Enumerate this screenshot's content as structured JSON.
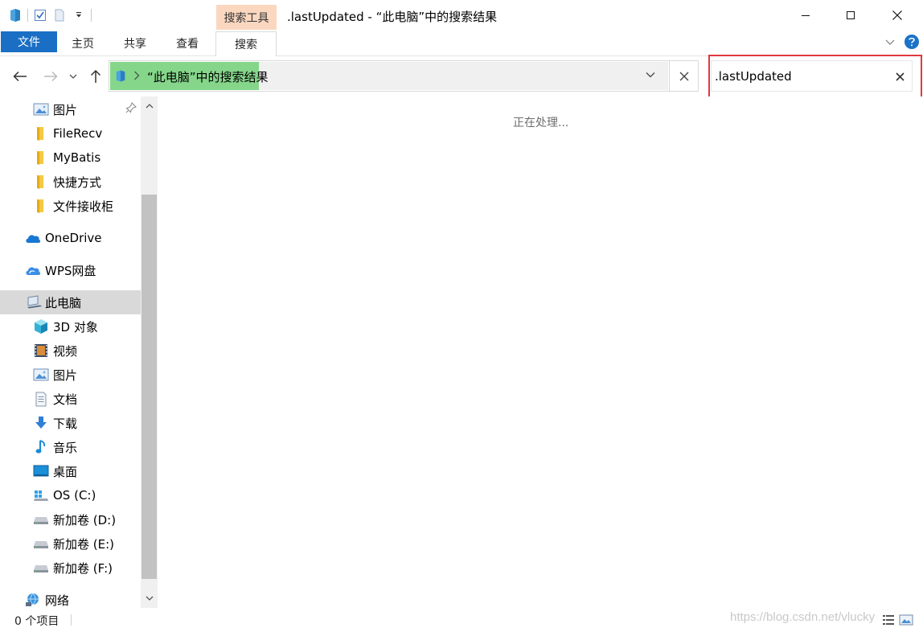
{
  "window": {
    "title": ".lastUpdated - “此电脑”中的搜索结果",
    "context_tab": "搜索工具"
  },
  "ribbon": {
    "tabs": [
      "文件",
      "主页",
      "共享",
      "查看",
      "搜索"
    ],
    "active_tab": "搜索"
  },
  "address": {
    "path": "“此电脑”中的搜索结果"
  },
  "search": {
    "value": ".lastUpdated"
  },
  "nav": {
    "items": [
      {
        "label": "图片",
        "icon": "pictures-icon",
        "pinned": true
      },
      {
        "label": "FileRecv",
        "icon": "folder-icon"
      },
      {
        "label": "MyBatis",
        "icon": "folder-icon"
      },
      {
        "label": "快捷方式",
        "icon": "folder-icon"
      },
      {
        "label": "文件接收柜",
        "icon": "folder-icon"
      },
      {
        "label": "OneDrive",
        "icon": "onedrive-icon"
      },
      {
        "label": "WPS网盘",
        "icon": "wps-cloud-icon"
      },
      {
        "label": "此电脑",
        "icon": "this-pc-icon",
        "selected": true
      },
      {
        "label": "3D 对象",
        "icon": "3d-objects-icon"
      },
      {
        "label": "视频",
        "icon": "videos-icon"
      },
      {
        "label": "图片",
        "icon": "pictures-icon"
      },
      {
        "label": "文档",
        "icon": "documents-icon"
      },
      {
        "label": "下载",
        "icon": "downloads-icon"
      },
      {
        "label": "音乐",
        "icon": "music-icon"
      },
      {
        "label": "桌面",
        "icon": "desktop-icon"
      },
      {
        "label": "OS (C:)",
        "icon": "os-drive-icon"
      },
      {
        "label": "新加卷 (D:)",
        "icon": "drive-icon"
      },
      {
        "label": "新加卷 (E:)",
        "icon": "drive-icon"
      },
      {
        "label": "新加卷 (F:)",
        "icon": "drive-icon"
      },
      {
        "label": "网络",
        "icon": "network-icon"
      }
    ]
  },
  "content": {
    "status_message": "正在处理..."
  },
  "statusbar": {
    "item_count": "0 个项目",
    "watermark": "https://blog.csdn.net/vlucky"
  },
  "colors": {
    "file_tab": "#1a6fc4",
    "context_tab": "#fbd7c0",
    "address_progress": "#85d68a",
    "highlight_box": "#e0393f",
    "selected_nav": "#d9d9d9"
  }
}
